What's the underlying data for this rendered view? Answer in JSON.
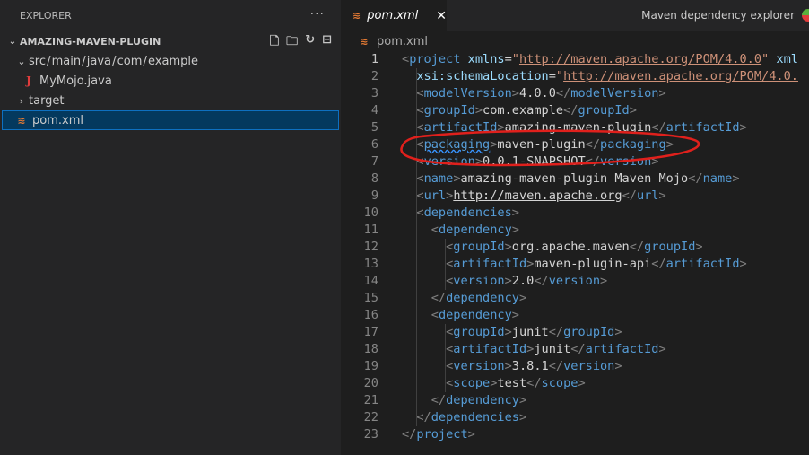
{
  "sidebar": {
    "title": "EXPLORER",
    "more": "···",
    "folder": "AMAZING-MAVEN-PLUGIN",
    "items": [
      {
        "label": "src / main / java / com / example"
      },
      {
        "label": "MyMojo.java"
      },
      {
        "label": "target"
      },
      {
        "label": "pom.xml"
      }
    ]
  },
  "tab": {
    "label": "pom.xml",
    "close": "✕"
  },
  "toolbar": {
    "maven_explorer": "Maven dependency explorer"
  },
  "breadcrumb": "pom.xml",
  "editor": {
    "lines": [
      [
        [
          "b",
          "<"
        ],
        [
          "t",
          "project"
        ],
        [
          "x",
          " "
        ],
        [
          "a",
          "xmlns"
        ],
        [
          "x",
          "="
        ],
        [
          "s",
          "\""
        ],
        [
          "su",
          "http://maven.apache.org/POM/4.0.0"
        ],
        [
          "s",
          "\""
        ],
        [
          "x",
          " "
        ],
        [
          "a",
          "xml"
        ]
      ],
      [
        [
          "x",
          "  "
        ],
        [
          "a",
          "xsi:schemaLocation"
        ],
        [
          "x",
          "="
        ],
        [
          "s",
          "\""
        ],
        [
          "su",
          "http://maven.apache.org/POM/4.0."
        ]
      ],
      [
        [
          "x",
          "  "
        ],
        [
          "b",
          "<"
        ],
        [
          "t",
          "modelVersion"
        ],
        [
          "b",
          ">"
        ],
        [
          "x",
          "4.0.0"
        ],
        [
          "b",
          "</"
        ],
        [
          "t",
          "modelVersion"
        ],
        [
          "b",
          ">"
        ]
      ],
      [
        [
          "x",
          "  "
        ],
        [
          "b",
          "<"
        ],
        [
          "t",
          "groupId"
        ],
        [
          "b",
          ">"
        ],
        [
          "x",
          "com.example"
        ],
        [
          "b",
          "</"
        ],
        [
          "t",
          "groupId"
        ],
        [
          "b",
          ">"
        ]
      ],
      [
        [
          "x",
          "  "
        ],
        [
          "b",
          "<"
        ],
        [
          "t",
          "artifactId"
        ],
        [
          "b",
          ">"
        ],
        [
          "x",
          "amazing-maven-plugin"
        ],
        [
          "b",
          "</"
        ],
        [
          "t",
          "artifactId"
        ],
        [
          "b",
          ">"
        ]
      ],
      [
        [
          "x",
          "  "
        ],
        [
          "b",
          "<"
        ],
        [
          "tq",
          "packaging"
        ],
        [
          "b",
          ">"
        ],
        [
          "x",
          "maven-plugin"
        ],
        [
          "b",
          "</"
        ],
        [
          "t",
          "packaging"
        ],
        [
          "b",
          ">"
        ]
      ],
      [
        [
          "x",
          "  "
        ],
        [
          "b",
          "<"
        ],
        [
          "t",
          "version"
        ],
        [
          "b",
          ">"
        ],
        [
          "x",
          "0.0.1-SNAPSHOT"
        ],
        [
          "b",
          "</"
        ],
        [
          "t",
          "version"
        ],
        [
          "b",
          ">"
        ]
      ],
      [
        [
          "x",
          "  "
        ],
        [
          "b",
          "<"
        ],
        [
          "t",
          "name"
        ],
        [
          "b",
          ">"
        ],
        [
          "x",
          "amazing-maven-plugin Maven Mojo"
        ],
        [
          "b",
          "</"
        ],
        [
          "t",
          "name"
        ],
        [
          "b",
          ">"
        ]
      ],
      [
        [
          "x",
          "  "
        ],
        [
          "b",
          "<"
        ],
        [
          "t",
          "url"
        ],
        [
          "b",
          ">"
        ],
        [
          "xu",
          "http://maven.apache.org"
        ],
        [
          "b",
          "</"
        ],
        [
          "t",
          "url"
        ],
        [
          "b",
          ">"
        ]
      ],
      [
        [
          "x",
          "  "
        ],
        [
          "b",
          "<"
        ],
        [
          "t",
          "dependencies"
        ],
        [
          "b",
          ">"
        ]
      ],
      [
        [
          "x",
          "    "
        ],
        [
          "b",
          "<"
        ],
        [
          "t",
          "dependency"
        ],
        [
          "b",
          ">"
        ]
      ],
      [
        [
          "x",
          "      "
        ],
        [
          "b",
          "<"
        ],
        [
          "t",
          "groupId"
        ],
        [
          "b",
          ">"
        ],
        [
          "x",
          "org.apache.maven"
        ],
        [
          "b",
          "</"
        ],
        [
          "t",
          "groupId"
        ],
        [
          "b",
          ">"
        ]
      ],
      [
        [
          "x",
          "      "
        ],
        [
          "b",
          "<"
        ],
        [
          "t",
          "artifactId"
        ],
        [
          "b",
          ">"
        ],
        [
          "x",
          "maven-plugin-api"
        ],
        [
          "b",
          "</"
        ],
        [
          "t",
          "artifactId"
        ],
        [
          "b",
          ">"
        ]
      ],
      [
        [
          "x",
          "      "
        ],
        [
          "b",
          "<"
        ],
        [
          "t",
          "version"
        ],
        [
          "b",
          ">"
        ],
        [
          "x",
          "2.0"
        ],
        [
          "b",
          "</"
        ],
        [
          "t",
          "version"
        ],
        [
          "b",
          ">"
        ]
      ],
      [
        [
          "x",
          "    "
        ],
        [
          "b",
          "</"
        ],
        [
          "t",
          "dependency"
        ],
        [
          "b",
          ">"
        ]
      ],
      [
        [
          "x",
          "    "
        ],
        [
          "b",
          "<"
        ],
        [
          "t",
          "dependency"
        ],
        [
          "b",
          ">"
        ]
      ],
      [
        [
          "x",
          "      "
        ],
        [
          "b",
          "<"
        ],
        [
          "t",
          "groupId"
        ],
        [
          "b",
          ">"
        ],
        [
          "x",
          "junit"
        ],
        [
          "b",
          "</"
        ],
        [
          "t",
          "groupId"
        ],
        [
          "b",
          ">"
        ]
      ],
      [
        [
          "x",
          "      "
        ],
        [
          "b",
          "<"
        ],
        [
          "t",
          "artifactId"
        ],
        [
          "b",
          ">"
        ],
        [
          "x",
          "junit"
        ],
        [
          "b",
          "</"
        ],
        [
          "t",
          "artifactId"
        ],
        [
          "b",
          ">"
        ]
      ],
      [
        [
          "x",
          "      "
        ],
        [
          "b",
          "<"
        ],
        [
          "t",
          "version"
        ],
        [
          "b",
          ">"
        ],
        [
          "x",
          "3.8.1"
        ],
        [
          "b",
          "</"
        ],
        [
          "t",
          "version"
        ],
        [
          "b",
          ">"
        ]
      ],
      [
        [
          "x",
          "      "
        ],
        [
          "b",
          "<"
        ],
        [
          "t",
          "scope"
        ],
        [
          "b",
          ">"
        ],
        [
          "x",
          "test"
        ],
        [
          "b",
          "</"
        ],
        [
          "t",
          "scope"
        ],
        [
          "b",
          ">"
        ]
      ],
      [
        [
          "x",
          "    "
        ],
        [
          "b",
          "</"
        ],
        [
          "t",
          "dependency"
        ],
        [
          "b",
          ">"
        ]
      ],
      [
        [
          "x",
          "  "
        ],
        [
          "b",
          "</"
        ],
        [
          "t",
          "dependencies"
        ],
        [
          "b",
          ">"
        ]
      ],
      [
        [
          "b",
          "</"
        ],
        [
          "t",
          "project"
        ],
        [
          "b",
          ">"
        ]
      ]
    ],
    "line_numbers": [
      "1",
      "2",
      "3",
      "4",
      "5",
      "6",
      "7",
      "8",
      "9",
      "10",
      "11",
      "12",
      "13",
      "14",
      "15",
      "16",
      "17",
      "18",
      "19",
      "20",
      "21",
      "22",
      "23"
    ]
  },
  "annotation_color": "#e0201c"
}
